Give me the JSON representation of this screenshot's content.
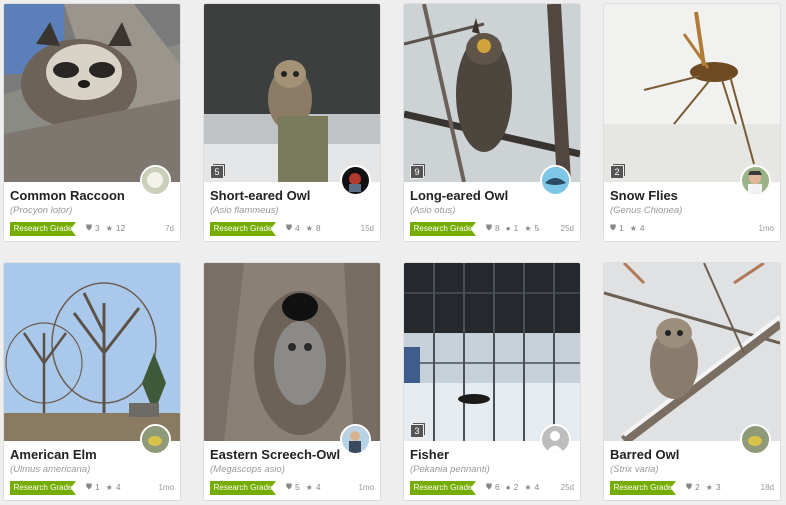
{
  "cards": [
    {
      "name": "Common Raccoon",
      "sci": "(Procyon lotor)",
      "grade": "Research Grade",
      "ids": "3",
      "faves": "12",
      "comments": "",
      "age": "7d",
      "photos": ""
    },
    {
      "name": "Short-eared Owl",
      "sci": "(Asio flammeus)",
      "grade": "Research Grade",
      "ids": "4",
      "faves": "8",
      "comments": "",
      "age": "15d",
      "photos": "5"
    },
    {
      "name": "Long-eared Owl",
      "sci": "(Asio otus)",
      "grade": "Research Grade",
      "ids": "8",
      "faves": "5",
      "comments": "1",
      "age": "25d",
      "photos": "9"
    },
    {
      "name": "Snow Flies",
      "sci": "(Genus Chionea)",
      "grade": "",
      "ids": "1",
      "faves": "4",
      "comments": "",
      "age": "1mo",
      "photos": "2"
    },
    {
      "name": "American Elm",
      "sci": "(Ulmus americana)",
      "grade": "Research Grade",
      "ids": "1",
      "faves": "4",
      "comments": "",
      "age": "1mo",
      "photos": ""
    },
    {
      "name": "Eastern Screech-Owl",
      "sci": "(Megascops asio)",
      "grade": "Research Grade",
      "ids": "5",
      "faves": "4",
      "comments": "",
      "age": "1mo",
      "photos": ""
    },
    {
      "name": "Fisher",
      "sci": "(Pekania pennanti)",
      "grade": "Research Grade",
      "ids": "6",
      "faves": "4",
      "comments": "2",
      "age": "25d",
      "photos": "3"
    },
    {
      "name": "Barred Owl",
      "sci": "(Strix varia)",
      "grade": "Research Grade",
      "ids": "2",
      "faves": "3",
      "comments": "",
      "age": "18d",
      "photos": ""
    }
  ],
  "icons": {
    "ids": "shield-icon",
    "faves": "star-icon",
    "comments": "comment-icon",
    "photos": "photo-stack-icon"
  },
  "colors": {
    "grade": "#74ac00",
    "background": "#eeeeee"
  }
}
